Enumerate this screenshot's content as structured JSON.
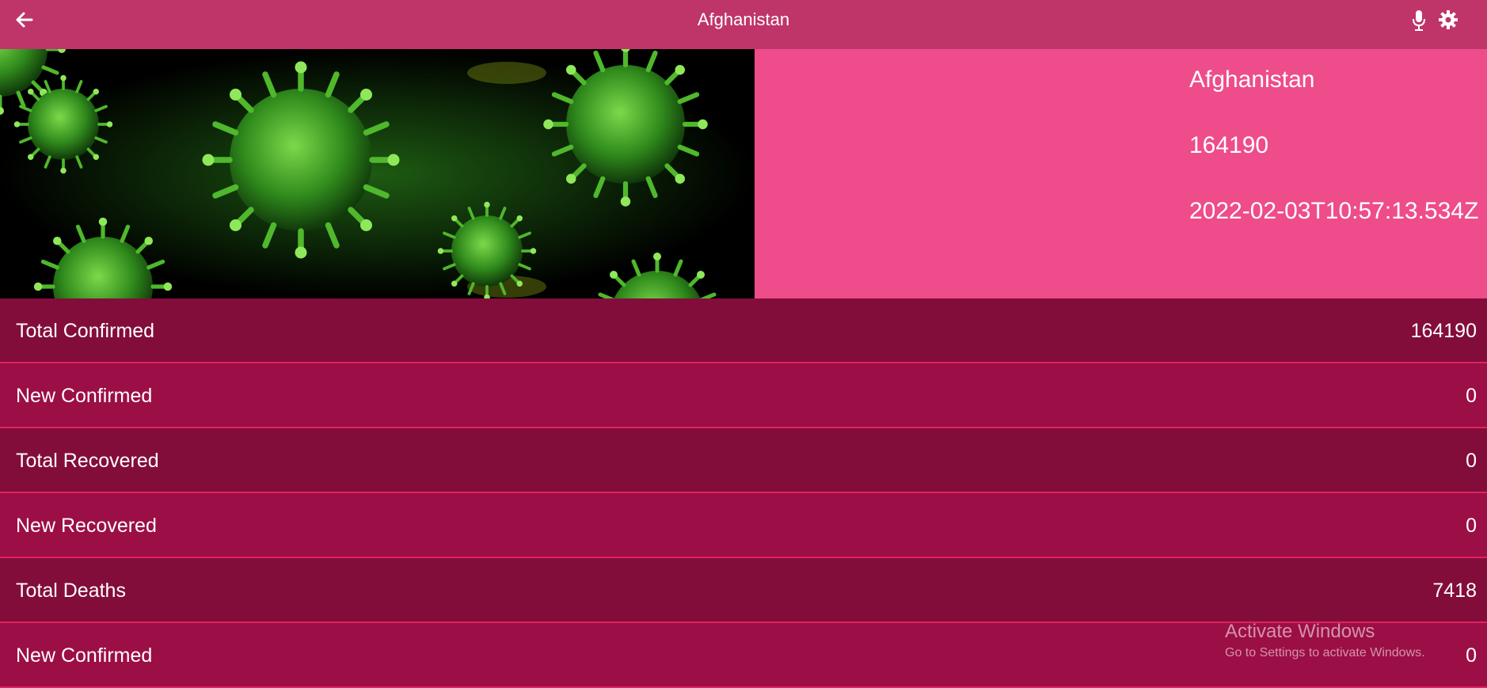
{
  "header": {
    "title": "Afghanistan",
    "back_icon": "arrow-left-icon",
    "mic_icon": "microphone-icon",
    "settings_icon": "gear-icon"
  },
  "country_card": {
    "name": "Afghanistan",
    "total": "164190",
    "updated": "2022-02-03T10:57:13.534Z",
    "image_icon": "coronavirus-image"
  },
  "stats": [
    {
      "label": "Total Confirmed",
      "value": "164190"
    },
    {
      "label": "New Confirmed",
      "value": "0"
    },
    {
      "label": "Total Recovered",
      "value": "0"
    },
    {
      "label": "New Recovered",
      "value": "0"
    },
    {
      "label": "Total Deaths",
      "value": "7418"
    },
    {
      "label": "New Confirmed",
      "value": "0"
    }
  ],
  "watermark": {
    "line1": "Activate Windows",
    "line2": "Go to Settings to activate Windows."
  },
  "colors": {
    "header": "#bf3569",
    "card": "#ee4c8b",
    "row_dark": "#830d3a",
    "row_light": "#9c0e46",
    "divider": "#e0225f"
  }
}
